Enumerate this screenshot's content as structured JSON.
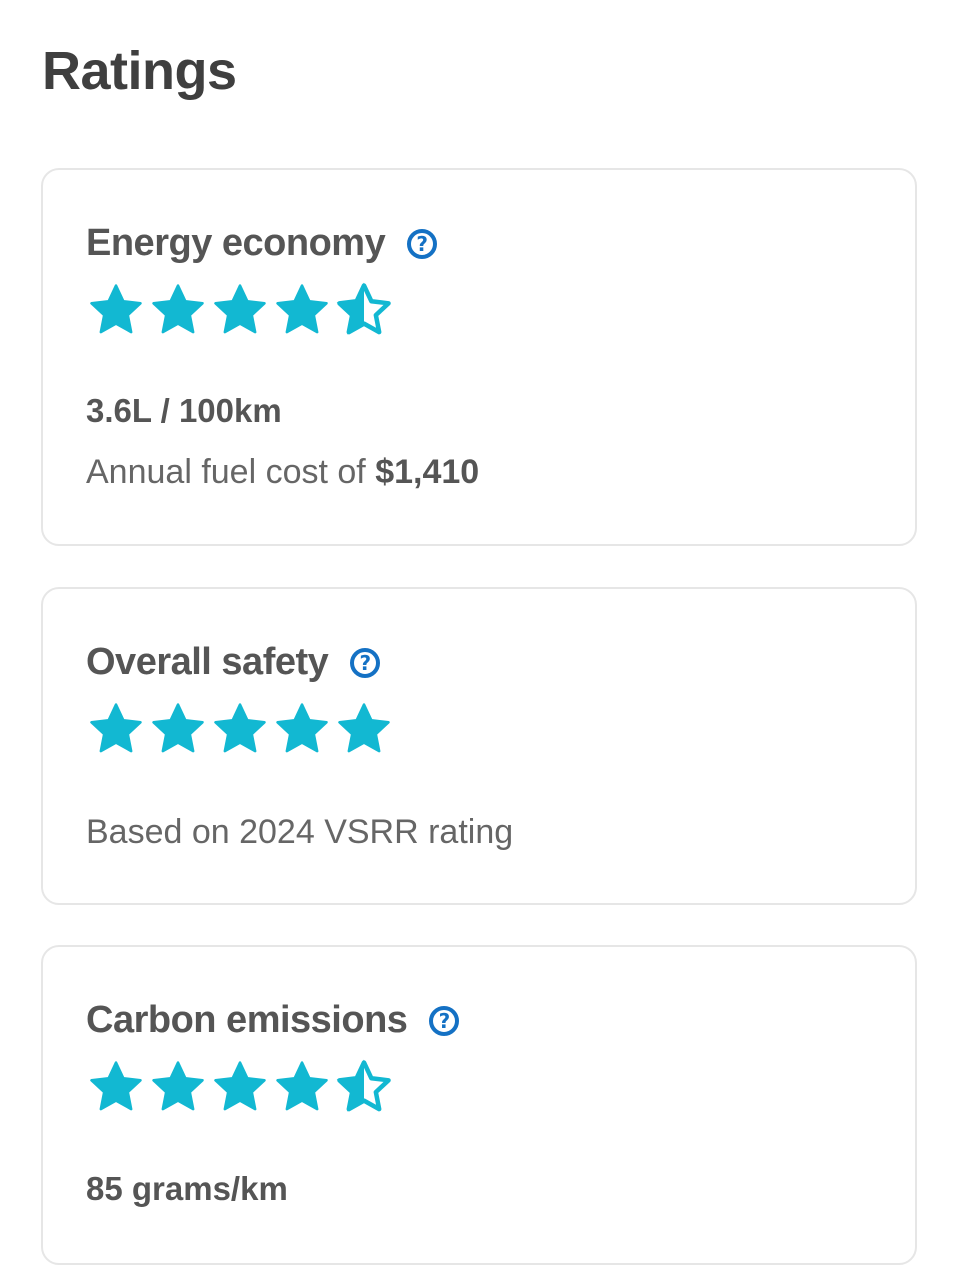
{
  "page": {
    "title": "Ratings"
  },
  "colors": {
    "star_filled": "#12b8d2",
    "star_empty": "#e6e6e6",
    "help_icon": "#1471c4"
  },
  "cards": [
    {
      "title": "Energy economy",
      "help_icon": "question-circle-icon",
      "rating": 4.5,
      "rating_max": 5,
      "metric": "3.6L / 100km",
      "note_prefix": "Annual fuel cost of ",
      "note_value": "$1,410"
    },
    {
      "title": "Overall safety",
      "help_icon": "question-circle-icon",
      "rating": 5,
      "rating_max": 5,
      "note": "Based on 2024 VSRR rating"
    },
    {
      "title": "Carbon emissions",
      "help_icon": "question-circle-icon",
      "rating": 4.5,
      "rating_max": 5,
      "metric": "85 grams/km"
    }
  ]
}
